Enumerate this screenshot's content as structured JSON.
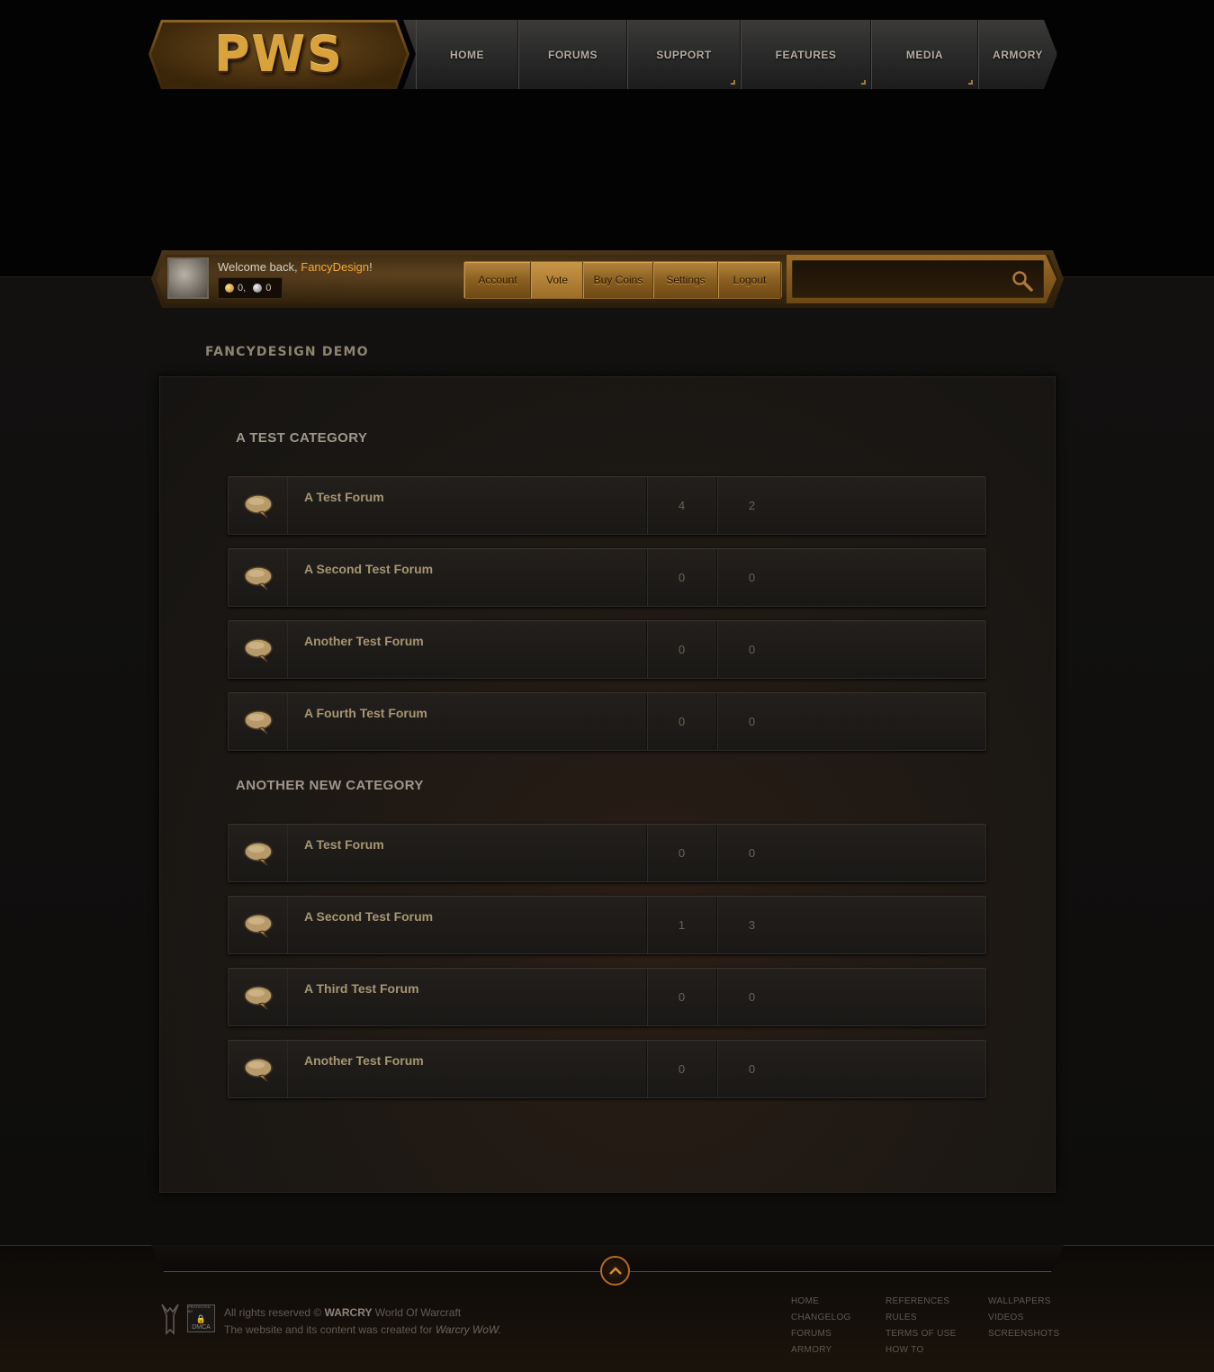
{
  "brand": {
    "logo_text": "PWS"
  },
  "nav": {
    "items": [
      {
        "label": "HOME",
        "has_dropdown": false
      },
      {
        "label": "FORUMS",
        "has_dropdown": false
      },
      {
        "label": "SUPPORT",
        "has_dropdown": true
      },
      {
        "label": "FEATURES",
        "has_dropdown": true
      },
      {
        "label": "MEDIA",
        "has_dropdown": true
      },
      {
        "label": "ARMORY",
        "has_dropdown": false
      }
    ]
  },
  "user": {
    "welcome_prefix": "Welcome back, ",
    "username": "FancyDesign",
    "welcome_suffix": "!",
    "gold_coins": "0,",
    "silver_coins": "0"
  },
  "user_menu": {
    "account": "Account",
    "vote": "Vote",
    "buy_coins": "Buy Coins",
    "settings": "Settings",
    "logout": "Logout",
    "active": "Vote"
  },
  "search": {
    "value": "",
    "placeholder": ""
  },
  "page": {
    "title": "FANCYDESIGN DEMO"
  },
  "categories": [
    {
      "title": "A TEST CATEGORY",
      "forums": [
        {
          "name": "A Test Forum",
          "topics": "4",
          "posts": "2"
        },
        {
          "name": "A Second Test Forum",
          "topics": "0",
          "posts": "0"
        },
        {
          "name": "Another Test Forum",
          "topics": "0",
          "posts": "0"
        },
        {
          "name": "A Fourth Test Forum",
          "topics": "0",
          "posts": "0"
        }
      ]
    },
    {
      "title": "ANOTHER NEW CATEGORY",
      "forums": [
        {
          "name": "A Test Forum",
          "topics": "0",
          "posts": "0"
        },
        {
          "name": "A Second Test Forum",
          "topics": "1",
          "posts": "3"
        },
        {
          "name": "A Third Test Forum",
          "topics": "0",
          "posts": "0"
        },
        {
          "name": "Another Test Forum",
          "topics": "0",
          "posts": "0"
        }
      ]
    }
  ],
  "footer": {
    "rights_prefix": "All rights reserved ©",
    "brand": "WARCRY",
    "brand_suffix": "World Of Warcraft",
    "created_prefix": "The website and its content was created for",
    "created_for": "Warcry WoW.",
    "dmca_top": "PROTECTED BY",
    "dmca_bottom": "DMCA",
    "col1": [
      "HOME",
      "CHANGELOG",
      "FORUMS",
      "ARMORY"
    ],
    "col2": [
      "REFERENCES",
      "RULES",
      "TERMS OF USE",
      "HOW TO"
    ],
    "col3": [
      "WALLPAPERS",
      "VIDEOS",
      "SCREENSHOTS"
    ]
  },
  "colors": {
    "accent_gold": "#f4a936",
    "forum_name": "#a89572",
    "background": "#030303"
  },
  "icons": {
    "forum": "speech-bubble-icon",
    "search": "magnifier-icon",
    "to_top": "chevron-up-icon"
  }
}
